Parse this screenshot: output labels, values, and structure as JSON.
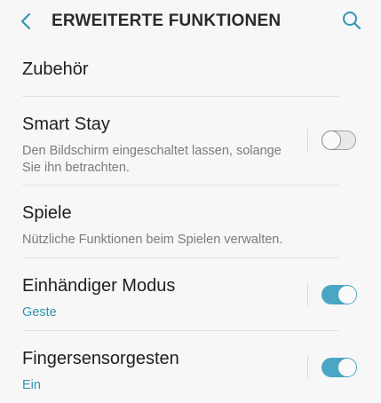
{
  "header": {
    "title": "ERWEITERTE FUNKTIONEN",
    "back_icon": "chevron-left-icon",
    "search_icon": "search-icon",
    "accent_color": "#2f96b4"
  },
  "items": [
    {
      "title": "Zubehör"
    },
    {
      "title": "Smart Stay",
      "subtitle": "Den Bildschirm eingeschaltet lassen, solange Sie ihn betrachten.",
      "toggle": "off"
    },
    {
      "title": "Spiele",
      "subtitle": "Nützliche Funktionen beim Spielen verwalten."
    },
    {
      "title": "Einhändiger Modus",
      "subtitle": "Geste",
      "toggle": "on"
    },
    {
      "title": "Fingersensorgesten",
      "subtitle": "Ein",
      "toggle": "on"
    }
  ]
}
